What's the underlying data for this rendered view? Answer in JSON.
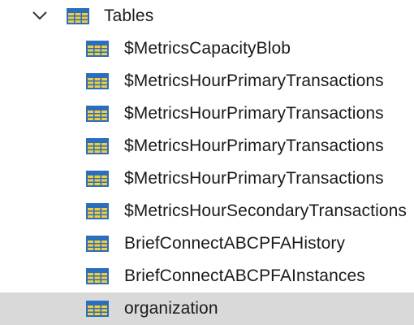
{
  "tree": {
    "root": {
      "label": "Tables",
      "expanded": true,
      "icon": "table-icon"
    },
    "items": [
      {
        "label": "$MetricsCapacityBlob",
        "selected": false
      },
      {
        "label": "$MetricsHourPrimaryTransactions",
        "selected": false
      },
      {
        "label": "$MetricsHourPrimaryTransactions",
        "selected": false
      },
      {
        "label": "$MetricsHourPrimaryTransactions",
        "selected": false
      },
      {
        "label": "$MetricsHourPrimaryTransactions",
        "selected": false
      },
      {
        "label": "$MetricsHourSecondaryTransactions",
        "selected": false
      },
      {
        "label": "BriefConnectABCPFAHistory",
        "selected": false
      },
      {
        "label": "BriefConnectABCPFAInstances",
        "selected": false
      },
      {
        "label": "organization",
        "selected": true
      }
    ]
  },
  "colors": {
    "icon_frame": "#2a6ebf",
    "icon_cells": "#f2cc3d",
    "selection": "#d9d9d9",
    "text": "#1a1a1a"
  }
}
